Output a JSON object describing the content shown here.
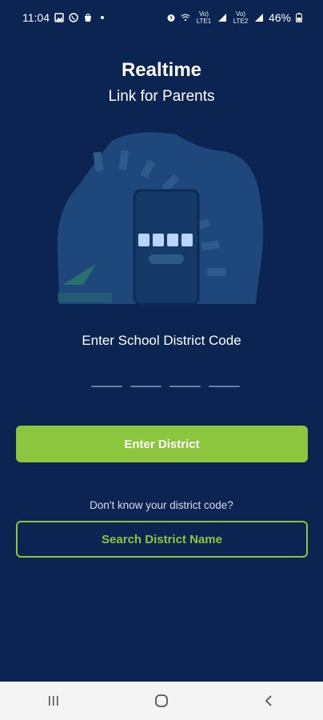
{
  "status_bar": {
    "time": "11:04",
    "signal_1": "Vo) LTE1",
    "signal_2": "Vo) LTE2",
    "battery": "46%"
  },
  "header": {
    "title": "Realtime",
    "subtitle": "Link for Parents"
  },
  "district_code": {
    "label": "Enter School District Code",
    "slot_count": 4,
    "values": [
      "",
      "",
      "",
      ""
    ]
  },
  "actions": {
    "enter_district_label": "Enter District",
    "help_text": "Don't know your district code?",
    "search_district_label": "Search District Name"
  },
  "colors": {
    "background": "#0c2452",
    "accent_green": "#8cc63f",
    "illustration_blob": "#1e477c",
    "nav_bar": "#f4f4f4"
  }
}
